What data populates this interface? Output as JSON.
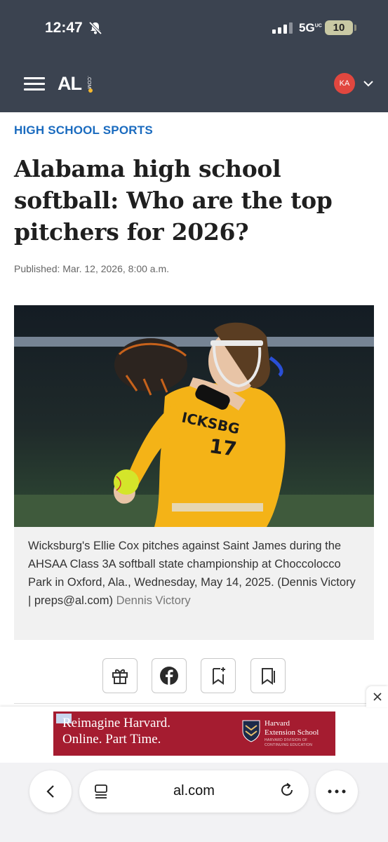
{
  "status_bar": {
    "time": "12:47",
    "network": "5G",
    "network_sup": "UC",
    "battery": "10"
  },
  "site_header": {
    "logo": "AL",
    "logo_sub": ".COM",
    "avatar_initials": "KA"
  },
  "article": {
    "section": "HIGH SCHOOL SPORTS",
    "headline": "Alabama high school softball: Who are the top pitchers for 2026?",
    "published": "Published: Mar. 12, 2026, 8:00 a.m.",
    "photo_jersey_text": "ICKSBG",
    "photo_jersey_number": "17",
    "caption": "Wicksburg's Ellie Cox pitches against Saint James during the AHSAA Class 3A softball state championship at Choccolocco Park in Oxford, Ala., Wednesday, May 14, 2025. (Dennis Victory | preps@al.com)",
    "caption_credit": "Dennis Victory"
  },
  "share_buttons": [
    {
      "name": "gift-icon"
    },
    {
      "name": "facebook-icon"
    },
    {
      "name": "bookmark-add-icon"
    },
    {
      "name": "bookmarks-icon"
    }
  ],
  "ad": {
    "line1": "Reimagine Harvard.",
    "line2": "Online. Part Time.",
    "brand1": "Harvard",
    "brand2": "Extension School",
    "brand3": "HARVARD DIVISION OF",
    "brand4": "CONTINUING EDUCATION"
  },
  "browser": {
    "url": "al.com"
  },
  "colors": {
    "header_bg": "#3b4350",
    "section_blue": "#1a6bbf",
    "avatar_red": "#e1473f",
    "ad_crimson": "#a51c30"
  }
}
